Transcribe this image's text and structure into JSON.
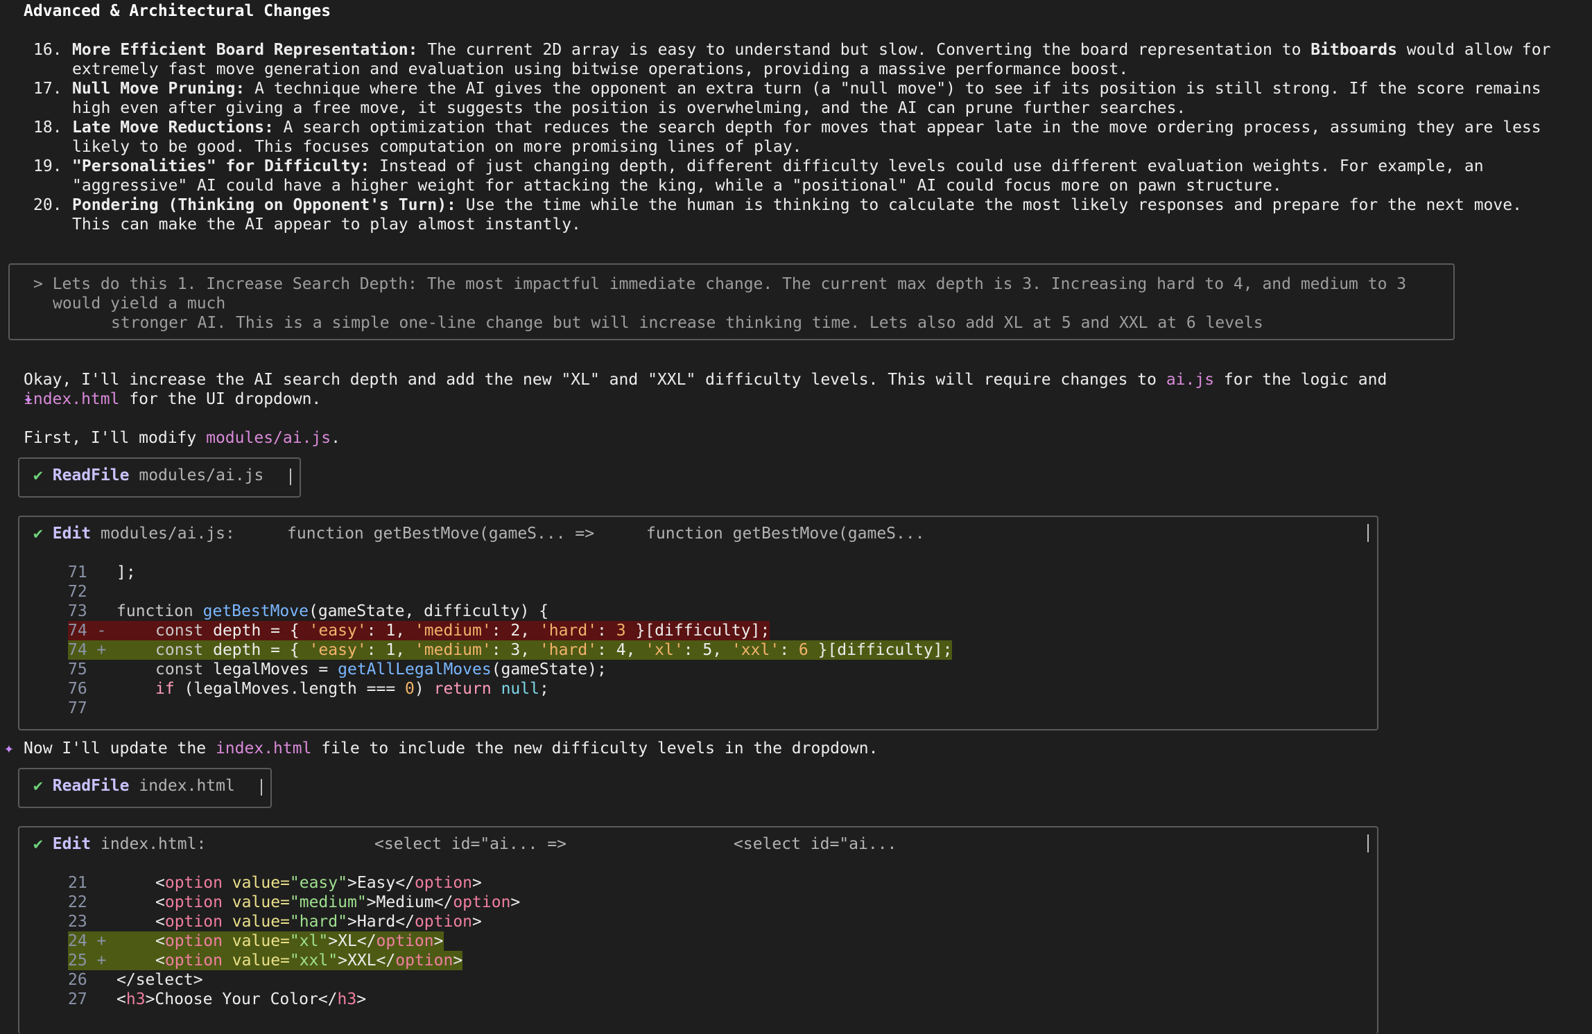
{
  "heading": "Advanced & Architectural Changes",
  "list": [
    {
      "num": "16.",
      "title": "More Efficient Board Representation:",
      "text_a": " The current 2D array is easy to understand but slow. Converting the board representation to ",
      "emph": "Bitboards",
      "text_b": " would allow for extremely fast move generation and evaluation using bitwise operations, providing a massive performance boost."
    },
    {
      "num": "17.",
      "title": "Null Move Pruning:",
      "text_a": " A technique where the AI gives the opponent an extra turn (a \"null move\") to see if its position is still strong. If the score remains high even after giving a free move, it suggests the position is overwhelming, and the AI can prune further searches.",
      "emph": "",
      "text_b": ""
    },
    {
      "num": "18.",
      "title": "Late Move Reductions:",
      "text_a": " A search optimization that reduces the search depth for moves that appear late in the move ordering process, assuming they are less likely to be good. This focuses computation on more promising lines of play.",
      "emph": "",
      "text_b": ""
    },
    {
      "num": "19.",
      "title": "\"Personalities\" for Difficulty:",
      "text_a": " Instead of just changing depth, different difficulty levels could use different evaluation weights. For example, an \"aggressive\" AI could have a higher weight for attacking the king, while a \"positional\" AI could focus more on pawn structure.",
      "emph": "",
      "text_b": ""
    },
    {
      "num": "20.",
      "title": "Pondering (Thinking on Opponent's Turn):",
      "text_a": " Use the time while the human is thinking to calculate the most likely responses and prepare for the next move. This can make the AI appear to play almost instantly.",
      "emph": "",
      "text_b": ""
    }
  ],
  "prompt": {
    "line1": "> Lets do this 1. Increase Search Depth: The most impactful immediate change. The current max depth is 3. Increasing hard to 4, and medium to 3",
    "line2": "would yield a much",
    "line3": "stronger AI. This is a simple one-line change but will increase thinking time. Lets also add XL at 5 and XXL at 6 levels"
  },
  "msg1": {
    "sparkle": "✦",
    "a": "Okay, I'll increase the AI search depth and add the new \"XL\" and \"XXL\" difficulty levels. This will require changes to ",
    "file1": "ai.js",
    "b": " for the logic and",
    "file2": "index.html",
    "c": " for the UI dropdown."
  },
  "msg2": {
    "a": "First, I'll modify ",
    "file": "modules/ai.js",
    "b": "."
  },
  "tool1": {
    "check": "✔",
    "name": "ReadFile",
    "arg": "modules/ai.js"
  },
  "edit1": {
    "check": "✔",
    "name": "Edit",
    "arg": "modules/ai.js:",
    "from": "function getBestMove(gameS... =>",
    "to": "function getBestMove(gameS...",
    "lines": {
      "l71": {
        "n": "71",
        "code": "];"
      },
      "l72": {
        "n": "72"
      },
      "l73": {
        "n": "73",
        "kw": "function",
        "fn": "getBestMove",
        "rest": "(gameState, difficulty) {"
      },
      "l74d": {
        "n": "74 -",
        "kw": "const",
        "a": " depth = { ",
        "s1": "'easy'",
        "b": ": 1, ",
        "s2": "'medium'",
        "c": ": 2, ",
        "s3": "'hard'",
        "d": ": ",
        "n3": "3",
        "e": " }[difficulty];"
      },
      "l74a": {
        "n": "74 +",
        "kw": "const",
        "a": " depth = { ",
        "s1": "'easy'",
        "b": ": 1, ",
        "s2": "'medium'",
        "c": ": 3, ",
        "s3": "'hard'",
        "d": ": 4, ",
        "s4": "'xl'",
        "e": ": 5, ",
        "s5": "'xxl'",
        "f": ": ",
        "n6": "6",
        "g": " }[difficulty];"
      },
      "l75": {
        "n": "75",
        "kw": "const",
        "a": " legalMoves = ",
        "fn": "getAllLegalMoves",
        "b": "(gameState);"
      },
      "l76": {
        "n": "76",
        "kw": "if",
        "a": " (legalMoves.length === ",
        "zero": "0",
        "b": ") ",
        "ret": "return",
        "nul": "null",
        "c": ";"
      },
      "l77": {
        "n": "77"
      }
    }
  },
  "msg3": {
    "sparkle": "✦",
    "a": "Now I'll update the ",
    "file": "index.html",
    "b": " file to include the new difficulty levels in the dropdown."
  },
  "tool2": {
    "check": "✔",
    "name": "ReadFile",
    "arg": "index.html"
  },
  "edit2": {
    "check": "✔",
    "name": "Edit",
    "arg": "index.html:",
    "from": "<select id=\"ai... =>",
    "to": "<select id=\"ai...",
    "lines": [
      {
        "n": "21",
        "val": "\"easy\"",
        "label": "Easy"
      },
      {
        "n": "22",
        "val": "\"medium\"",
        "label": "Medium"
      },
      {
        "n": "23",
        "val": "\"hard\"",
        "label": "Hard"
      },
      {
        "n": "24 +",
        "val": "\"xl\"",
        "label": "XL"
      },
      {
        "n": "25 +",
        "val": "\"xxl\"",
        "label": "XXL"
      }
    ],
    "l26": {
      "n": "26",
      "code": "</select>"
    },
    "l27": {
      "n": "27",
      "lt": "<",
      "tag": "h3",
      "gt": ">",
      "text": "Choose Your Color",
      "lt2": "</",
      "tag2": "h3",
      "gt2": ">"
    },
    "tok": {
      "lt": "<",
      "option": "option",
      "value": " value=",
      "gt": ">",
      "close": "</"
    }
  }
}
